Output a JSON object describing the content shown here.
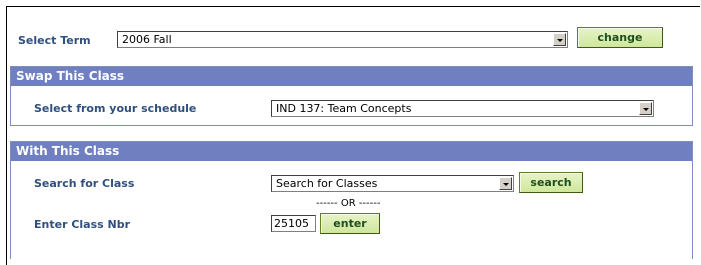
{
  "term": {
    "label": "Select Term",
    "value": "2006 Fall",
    "change_button": "change"
  },
  "swap_section": {
    "title": "Swap This Class",
    "label": "Select from your schedule",
    "value": "IND 137: Team Concepts"
  },
  "with_section": {
    "title": "With This Class",
    "search_label": "Search for Class",
    "search_value": "Search for Classes",
    "search_button": "search",
    "or_text": "------ OR ------",
    "nbr_label": "Enter Class Nbr",
    "nbr_value": "25105",
    "enter_button": "enter"
  }
}
